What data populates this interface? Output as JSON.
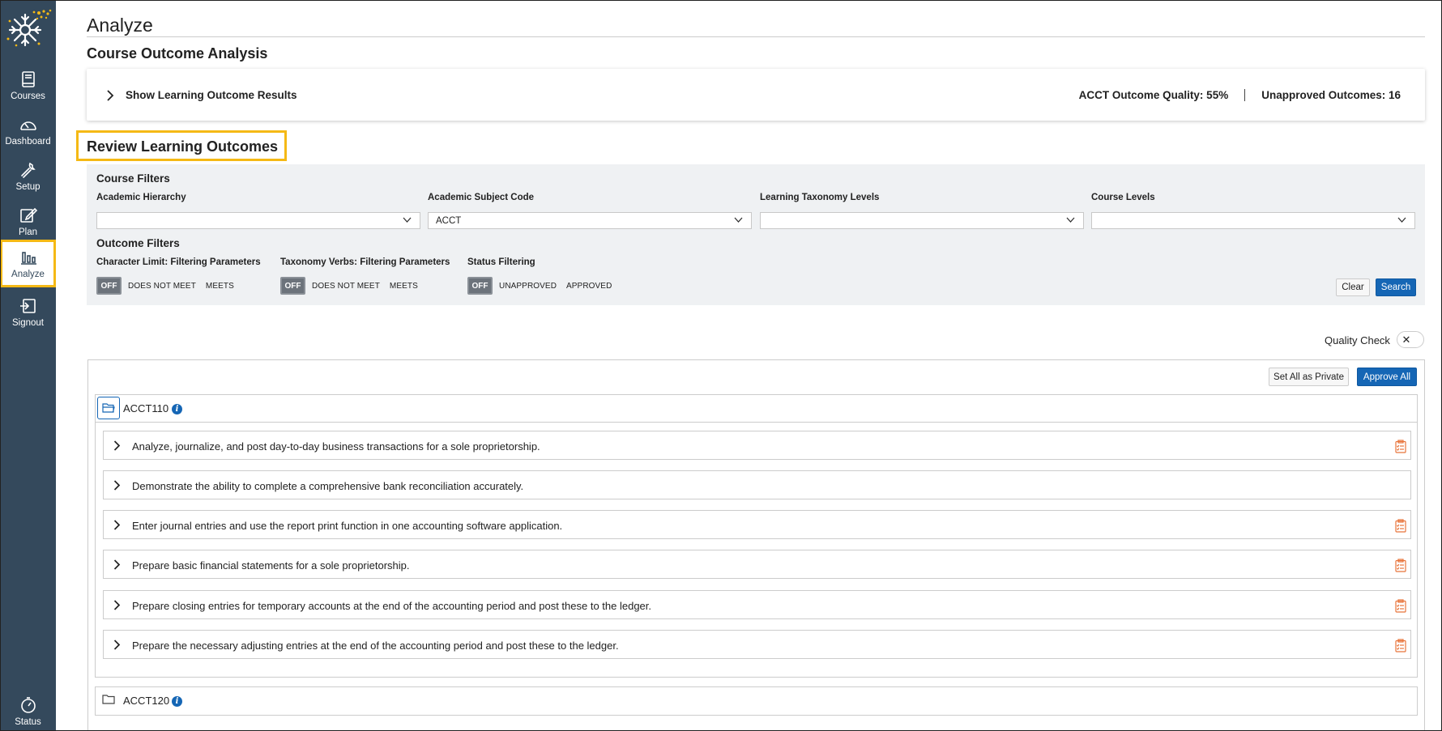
{
  "sidebar": {
    "items": [
      {
        "label": "Courses",
        "icon": "book-icon"
      },
      {
        "label": "Dashboard",
        "icon": "gauge-icon"
      },
      {
        "label": "Setup",
        "icon": "wrench-icon"
      },
      {
        "label": "Plan",
        "icon": "edit-icon"
      },
      {
        "label": "Analyze",
        "icon": "bar-chart-icon",
        "active": true
      },
      {
        "label": "Signout",
        "icon": "signout-icon"
      }
    ],
    "status_label": "Status"
  },
  "header": {
    "page_title": "Analyze",
    "section_title": "Course Outcome Analysis"
  },
  "results": {
    "show_label": "Show Learning Outcome Results",
    "quality": "ACCT Outcome Quality: 55%",
    "unapproved": "Unapproved Outcomes: 16"
  },
  "review": {
    "title": "Review Learning Outcomes"
  },
  "filters": {
    "course_filters_title": "Course Filters",
    "academic_hierarchy_label": "Academic Hierarchy",
    "academic_hierarchy_value": "",
    "subject_code_label": "Academic Subject Code",
    "subject_code_value": "ACCT",
    "taxonomy_levels_label": "Learning Taxonomy Levels",
    "taxonomy_levels_value": "",
    "course_levels_label": "Course Levels",
    "course_levels_value": "",
    "outcome_filters_title": "Outcome Filters",
    "char_limit_label": "Character Limit: Filtering Parameters",
    "char_limit_off": "OFF",
    "char_limit_opt1": "DOES NOT MEET",
    "char_limit_opt2": "MEETS",
    "tax_verbs_label": "Taxonomy Verbs: Filtering Parameters",
    "tax_verbs_off": "OFF",
    "tax_verbs_opt1": "DOES NOT MEET",
    "tax_verbs_opt2": "MEETS",
    "status_label": "Status Filtering",
    "status_off": "OFF",
    "status_opt1": "UNAPPROVED",
    "status_opt2": "APPROVED",
    "clear": "Clear",
    "search": "Search"
  },
  "quality_check": {
    "label": "Quality Check",
    "knob": "✕"
  },
  "list": {
    "set_private": "Set All as Private",
    "approve_all": "Approve All",
    "courses": [
      {
        "name": "ACCT110",
        "info": "i",
        "outcomes": [
          {
            "text": "Analyze, journalize, and post day-to-day business transactions for a sole proprietorship.",
            "flag": true
          },
          {
            "text": "Demonstrate the ability to complete a comprehensive bank reconciliation accurately.",
            "flag": false
          },
          {
            "text": "Enter journal entries and use the report print function in one accounting software application.",
            "flag": true
          },
          {
            "text": "Prepare basic financial statements for a sole proprietorship.",
            "flag": true
          },
          {
            "text": "Prepare closing entries for temporary accounts at the end of the accounting period and post these to the ledger.",
            "flag": true
          },
          {
            "text": "Prepare the necessary adjusting entries at the end of the accounting period and post these to the ledger.",
            "flag": true
          }
        ]
      },
      {
        "name": "ACCT120",
        "info": "i"
      }
    ]
  },
  "colors": {
    "sidebar_bg": "#34495c",
    "highlight": "#f5b915",
    "primary": "#1566b5",
    "flag": "#e8743b"
  }
}
